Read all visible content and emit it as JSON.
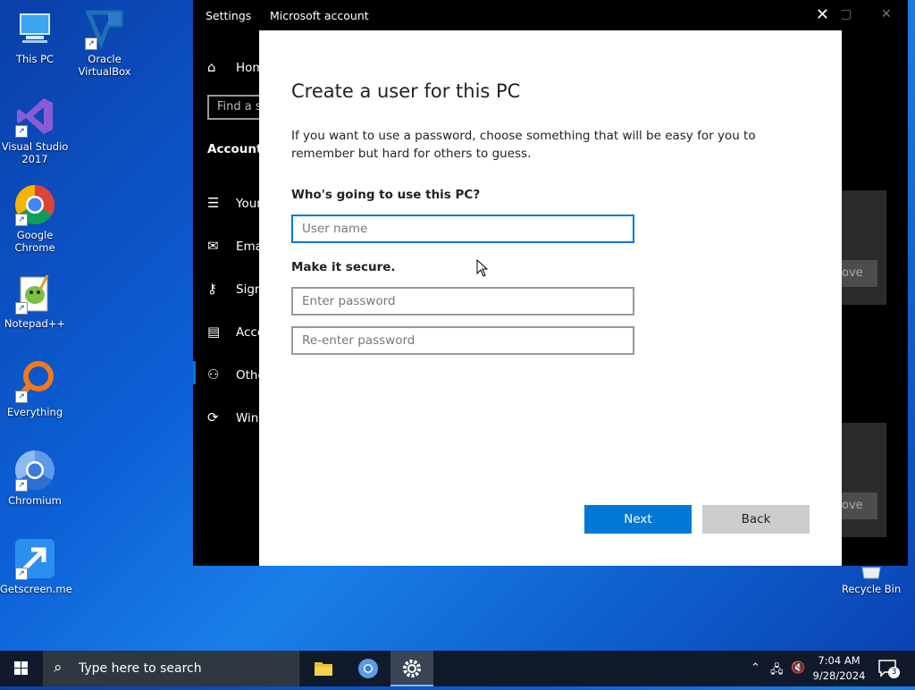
{
  "desktop": {
    "icons": [
      {
        "label": "This PC"
      },
      {
        "label": "Oracle VirtualBox"
      },
      {
        "label": "Visual Studio 2017"
      },
      {
        "label": "Google Chrome"
      },
      {
        "label": "Notepad++"
      },
      {
        "label": "Everything"
      },
      {
        "label": "Chromium"
      },
      {
        "label": "Getscreen.me"
      },
      {
        "label": "Recycle Bin"
      }
    ]
  },
  "settings": {
    "title": "Settings",
    "search_placeholder": "Find a s",
    "heading": "Accounts",
    "nav": [
      {
        "label": "Hom",
        "icon": "home-icon"
      },
      {
        "label": "Your",
        "icon": "person-card-icon"
      },
      {
        "label": "Ema",
        "icon": "mail-icon"
      },
      {
        "label": "Sign",
        "icon": "key-icon"
      },
      {
        "label": "Acce",
        "icon": "briefcase-icon"
      },
      {
        "label": "Othe",
        "icon": "add-person-icon"
      },
      {
        "label": "Win",
        "icon": "sync-icon"
      }
    ],
    "panel_buttons": [
      "ove",
      "ove"
    ]
  },
  "dialog": {
    "window_title": "Microsoft account",
    "heading": "Create a user for this PC",
    "description": "If you want to use a password, choose something that will be easy for you to remember but hard for others to guess.",
    "who_label": "Who's going to use this PC?",
    "username_placeholder": "User name",
    "secure_label": "Make it secure.",
    "password_placeholder": "Enter password",
    "reenter_placeholder": "Re-enter password",
    "next_label": "Next",
    "back_label": "Back"
  },
  "taskbar": {
    "search_placeholder": "Type here to search",
    "time": "7:04 AM",
    "date": "9/28/2024",
    "notification_count": "3"
  },
  "colors": {
    "accent": "#0078d7",
    "desktop": "#0d5fd6",
    "taskbar": "#101a2a"
  }
}
